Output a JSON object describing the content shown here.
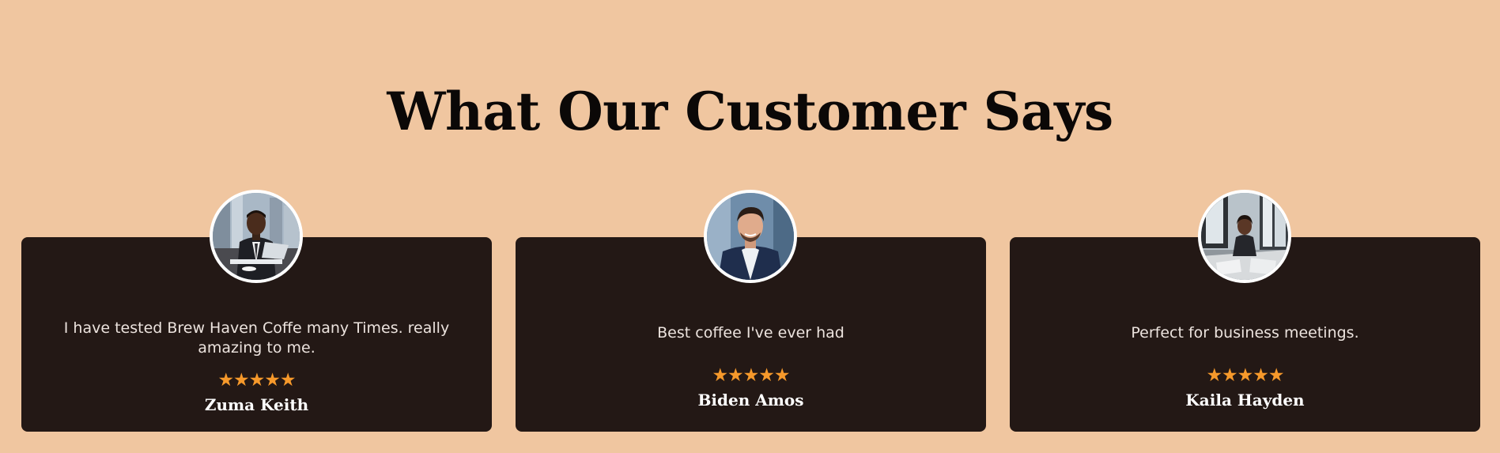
{
  "section": {
    "title": "What Our Customer Says"
  },
  "testimonials": [
    {
      "quote": "I have tested Brew Haven Coffe many Times. really amazing to me.",
      "rating": 5,
      "stars": "★★★★★",
      "name": "Zuma Keith"
    },
    {
      "quote": "Best coffee I've ever had",
      "rating": 5,
      "stars": "★★★★★",
      "name": "Biden Amos"
    },
    {
      "quote": "Perfect for business meetings.",
      "rating": 5,
      "stars": "★★★★★",
      "name": "Kaila Hayden"
    }
  ],
  "colors": {
    "background": "#f0c6a0",
    "card": "#231815",
    "star": "#f6992b",
    "heading": "#0b0807",
    "name": "#ffffff"
  }
}
